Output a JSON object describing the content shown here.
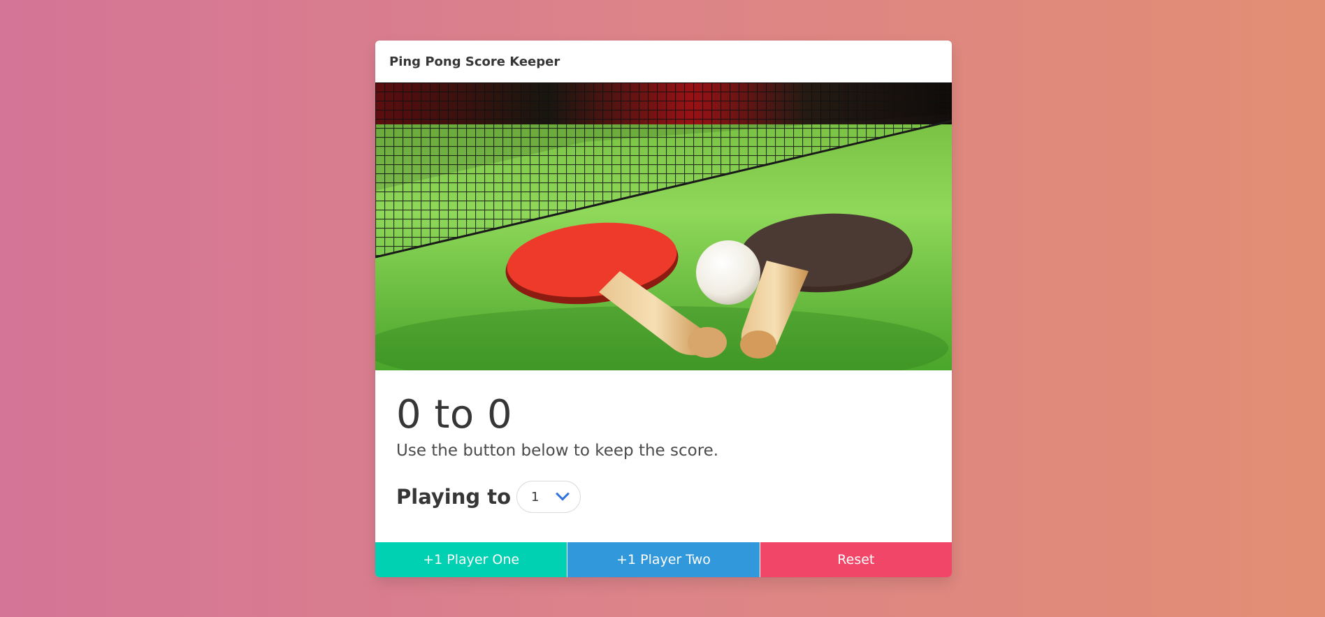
{
  "header": {
    "title": "Ping Pong Score Keeper"
  },
  "image": {
    "icon": "ping-pong-photo"
  },
  "score": {
    "player_one": "0",
    "separator": "to",
    "player_two": "0"
  },
  "subtitle": "Use the button below to keep the score.",
  "playing_to": {
    "label": "Playing to",
    "selected": "1"
  },
  "buttons": {
    "player_one": "+1 Player One",
    "player_two": "+1 Player Two",
    "reset": "Reset"
  },
  "colors": {
    "player_one": "#00d1b2",
    "player_two": "#3298dc",
    "reset": "#f14668",
    "select_arrow": "#3273dc"
  }
}
